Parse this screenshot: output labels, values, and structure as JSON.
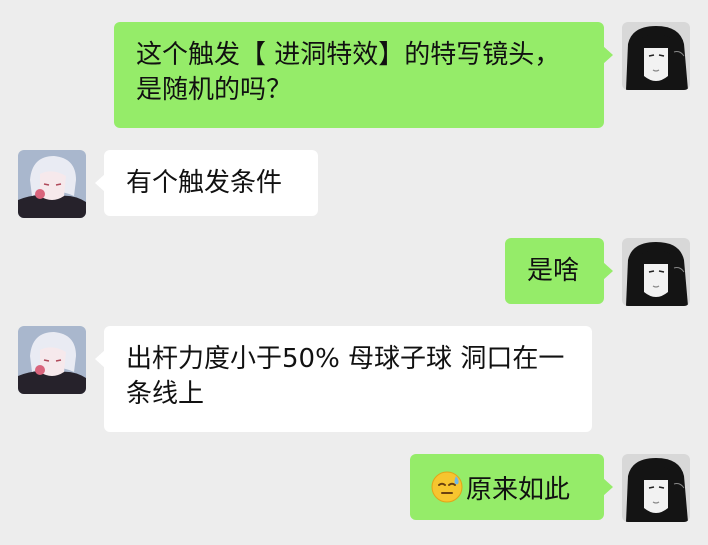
{
  "messages": [
    {
      "side": "right",
      "text": "这个触发【 进洞特效】的特写镜头，是随机的吗？"
    },
    {
      "side": "left",
      "text": "有个触发条件"
    },
    {
      "side": "right",
      "text": "是啥"
    },
    {
      "side": "left",
      "text": "出杆力度小于50% 母球子球 洞口在一条线上"
    },
    {
      "side": "right",
      "emoji": "sweat-smile-face",
      "text": "原来如此"
    }
  ],
  "colors": {
    "background": "#ededed",
    "outgoing_bubble": "#95ec69",
    "incoming_bubble": "#ffffff"
  }
}
